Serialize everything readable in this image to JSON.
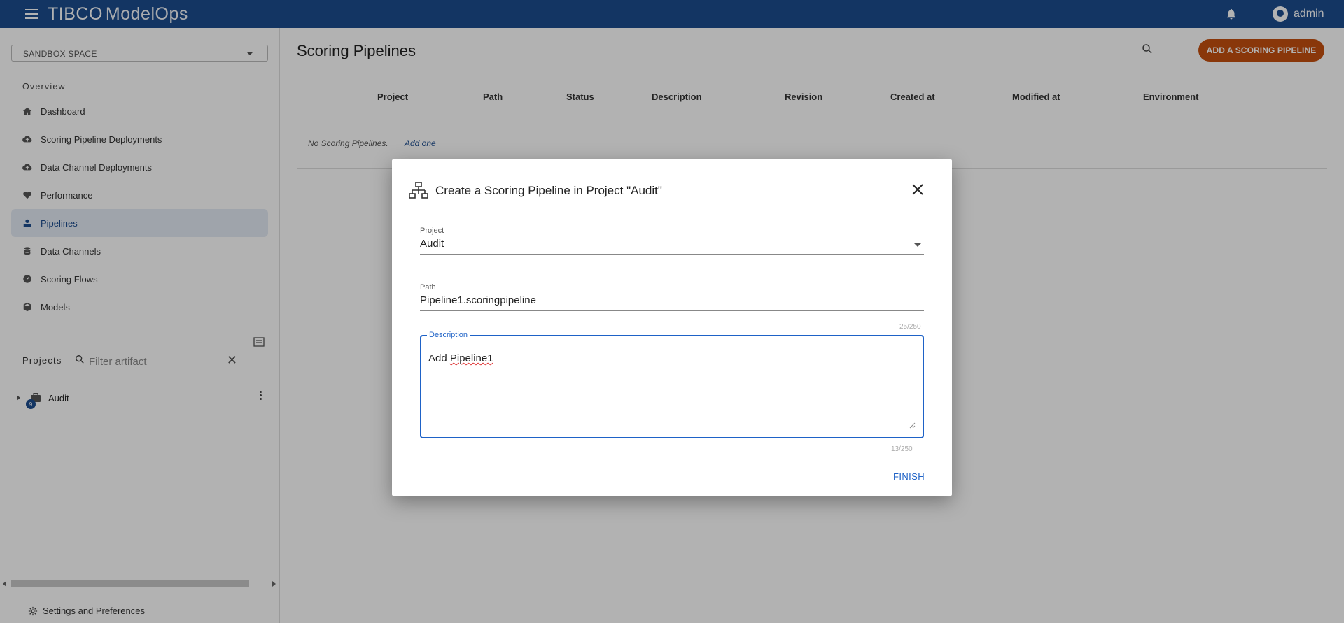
{
  "topbar": {
    "brand_main": "TIBCO",
    "brand_product": "ModelOps",
    "user": "admin"
  },
  "sidebar": {
    "space_selector": "SANDBOX SPACE",
    "overview_label": "Overview",
    "items": [
      {
        "label": "Dashboard",
        "icon": "home-icon"
      },
      {
        "label": "Scoring Pipeline Deployments",
        "icon": "cloud-upload-icon"
      },
      {
        "label": "Data Channel Deployments",
        "icon": "cloud-upload-icon"
      },
      {
        "label": "Performance",
        "icon": "heart-pulse-icon"
      },
      {
        "label": "Pipelines",
        "icon": "pipeline-icon",
        "active": true
      },
      {
        "label": "Data Channels",
        "icon": "database-icon"
      },
      {
        "label": "Scoring Flows",
        "icon": "gauge-icon"
      },
      {
        "label": "Models",
        "icon": "cube-icon"
      }
    ],
    "projects_label": "Projects",
    "filter_placeholder": "Filter artifact",
    "tree": [
      {
        "label": "Audit",
        "badge": "9"
      }
    ],
    "settings_label": "Settings and Preferences"
  },
  "main": {
    "title": "Scoring Pipelines",
    "add_button": "ADD A SCORING PIPELINE",
    "columns": [
      "Project",
      "Path",
      "Status",
      "Description",
      "Revision",
      "Created at",
      "Modified at",
      "Environment"
    ],
    "empty_message": "No Scoring Pipelines.",
    "empty_link": "Add one"
  },
  "dialog": {
    "title": "Create a Scoring Pipeline in Project \"Audit\"",
    "project_label": "Project",
    "project_value": "Audit",
    "path_label": "Path",
    "path_value": "Pipeline1.scoringpipeline",
    "path_counter": "25/250",
    "description_label": "Description",
    "description_word1": "Add ",
    "description_word2": "Pipeline1",
    "description_counter": "13/250",
    "finish_label": "FINISH"
  },
  "colors": {
    "topbar": "#1c4c8e",
    "accent_button": "#c5500f",
    "focus_blue": "#1e62c7"
  }
}
